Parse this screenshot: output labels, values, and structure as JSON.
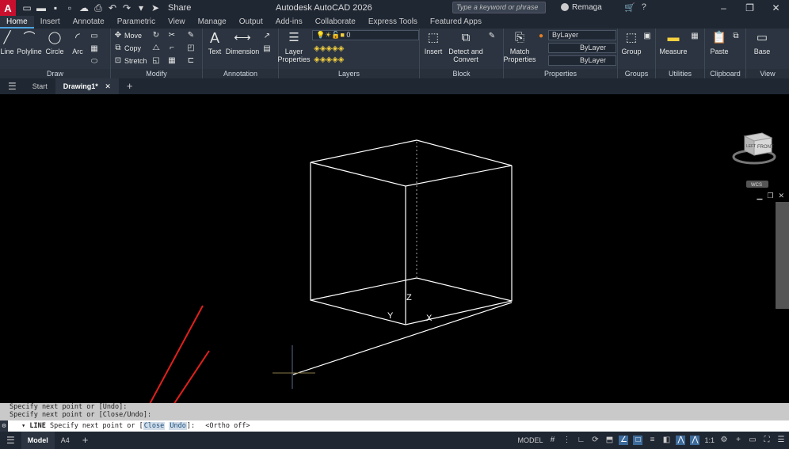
{
  "app": {
    "logo": "A",
    "title": "Autodesk AutoCAD 2026",
    "share_label": "Share",
    "search_placeholder": "Type a keyword or phrase",
    "user_name": "Remaga"
  },
  "ribbon_tabs": [
    "Home",
    "Insert",
    "Annotate",
    "Parametric",
    "View",
    "Manage",
    "Output",
    "Add-ins",
    "Collaborate",
    "Express Tools",
    "Featured Apps"
  ],
  "panels": {
    "draw": {
      "title": "Draw",
      "tools": [
        "Line",
        "Polyline",
        "Circle",
        "Arc"
      ]
    },
    "modify": {
      "title": "Modify",
      "tools": [
        "Move",
        "Copy",
        "Stretch"
      ]
    },
    "annotation": {
      "title": "Annotation",
      "tools": [
        "Text",
        "Dimension"
      ]
    },
    "layers": {
      "title": "Layers",
      "tool": "Layer Properties",
      "current_layer": "0"
    },
    "block": {
      "title": "Block",
      "tools": [
        "Insert",
        "Detect and Convert"
      ]
    },
    "properties": {
      "title": "Properties",
      "tool": "Match Properties",
      "color": "ByLayer",
      "linetype": "ByLayer",
      "lineweight": "ByLayer"
    },
    "groups": {
      "title": "Groups",
      "tool": "Group"
    },
    "utilities": {
      "title": "Utilities",
      "tool": "Measure"
    },
    "clipboard": {
      "title": "Clipboard",
      "tool": "Paste"
    },
    "view": {
      "title": "View",
      "tool": "Base"
    }
  },
  "file_tabs": [
    "Start",
    "Drawing1*"
  ],
  "viewcube": {
    "top": "TOP",
    "front": "FRONT",
    "left": "LEFT",
    "wcs": "WCS"
  },
  "axes": {
    "x": "X",
    "y": "Y",
    "z": "Z"
  },
  "command": {
    "history": [
      "Specify next point or [Undo]:",
      "Specify next point or [Close/Undo]:"
    ],
    "prompt_cmd": "LINE",
    "prompt_text": "Specify next point or [",
    "option_close": "Close",
    "option_undo": "Undo",
    "prompt_end": "]:",
    "status_msg": "<Ortho off>"
  },
  "status": {
    "layout_tabs": [
      "Model",
      "A4"
    ],
    "model_label": "MODEL",
    "scale": "1:1"
  },
  "colors": {
    "annotation_arrow": "#e0201c",
    "cube_lines": "#ffffff",
    "accent": "#4fa3e0"
  }
}
